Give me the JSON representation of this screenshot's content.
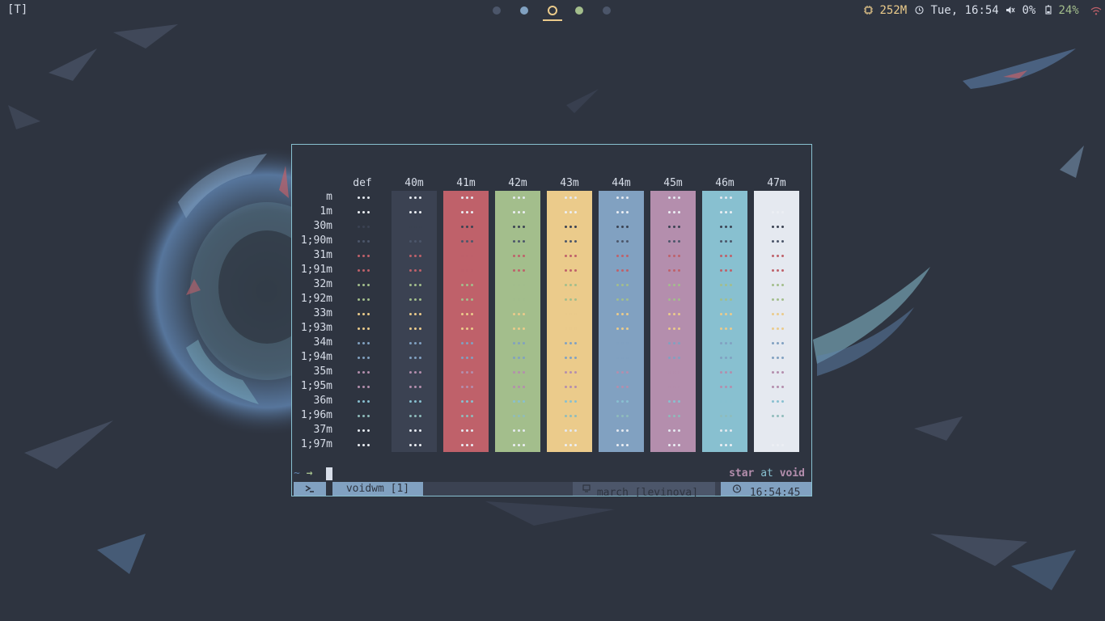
{
  "topbar": {
    "tag_label": "[T]",
    "workspaces": [
      {
        "color": "#4c566a",
        "style": "dot"
      },
      {
        "color": "#81a1c1",
        "style": "dot"
      },
      {
        "color": "#ebcb8b",
        "style": "ring",
        "active": true
      },
      {
        "color": "#a3be8c",
        "style": "dot"
      },
      {
        "color": "#4c566a",
        "style": "dot"
      }
    ],
    "memory": "252M",
    "datetime": "Tue, 16:54",
    "volume": "0%",
    "battery": "24%",
    "icons": [
      "cpu-icon",
      "clock-icon",
      "volume-muted-icon",
      "battery-icon",
      "wifi-icon"
    ]
  },
  "colortest": {
    "headers": [
      "def",
      "40m",
      "41m",
      "42m",
      "43m",
      "44m",
      "45m",
      "46m",
      "47m"
    ],
    "rows": [
      "m",
      "1m",
      "30m",
      "1;90m",
      "31m",
      "1;91m",
      "32m",
      "1;92m",
      "33m",
      "1;93m",
      "34m",
      "1;94m",
      "35m",
      "1;95m",
      "36m",
      "1;96m",
      "37m",
      "1;97m"
    ],
    "cell_text": "•••",
    "backgrounds": [
      "#2e3440",
      "#3b4252",
      "#bf616a",
      "#a3be8c",
      "#ebcb8b",
      "#81a1c1",
      "#b48ead",
      "#88c0d0",
      "#e5e9f0"
    ],
    "row_colors": [
      "#e5e9f0",
      "#eceff4",
      "#3b4252",
      "#4c566a",
      "#bf616a",
      "#bf616a",
      "#a3be8c",
      "#a3be8c",
      "#ebcb8b",
      "#ebcb8b",
      "#81a1c1",
      "#81a1c1",
      "#b48ead",
      "#b48ead",
      "#88c0d0",
      "#8fbcbb",
      "#e5e9f0",
      "#eceff4"
    ]
  },
  "prompt": {
    "tilde": "~",
    "arrow": "→",
    "user": "star",
    "at": "at",
    "host": "void"
  },
  "tmux": {
    "window": "voidwm [1]",
    "host": "march [levinova]",
    "clock": "16:54:45"
  },
  "colors": {
    "bg": "#2e3440",
    "border": "#88c0d0",
    "accent": "#ebcb8b",
    "prompt_user": "#b48ead",
    "prompt_at": "#88c0d0",
    "arrow": "#a3be8c"
  }
}
